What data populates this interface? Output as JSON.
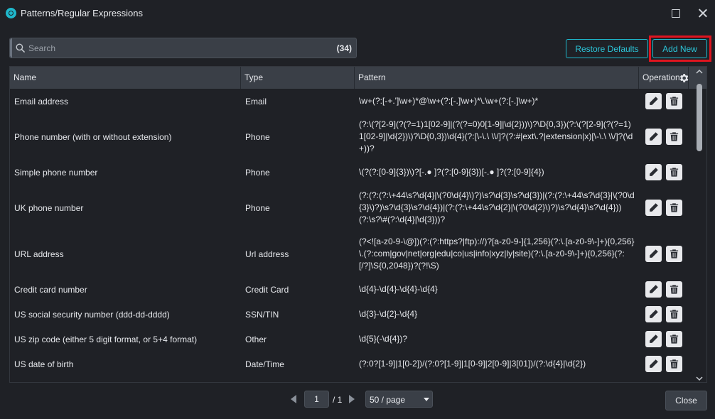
{
  "window": {
    "title": "Patterns/Regular Expressions",
    "icons": {
      "app": "app-logo-icon",
      "maximize": "maximize-icon",
      "close": "close-icon"
    }
  },
  "search": {
    "placeholder": "Search",
    "value": "",
    "count": "(34)"
  },
  "toolbar": {
    "restore_label": "Restore Defaults",
    "add_new_label": "Add New",
    "highlight_color": "#e0141f",
    "accent_color": "#1fb8cc"
  },
  "table": {
    "headers": {
      "name": "Name",
      "type": "Type",
      "pattern": "Pattern",
      "operation": "Operation"
    },
    "rows": [
      {
        "name": "Email address",
        "type": "Email",
        "pattern": "\\w+(?:[-+.']\\w+)*@\\w+(?:[-.]\\w+)*\\.\\w+(?:[-.]\\w+)*"
      },
      {
        "name": "Phone number (with or without extension)",
        "type": "Phone",
        "pattern": "(?:\\(?[2-9](?(?=1)1[02-9]|(?(?=0)0[1-9]|\\d{2}))\\)?\\D{0,3})(?:\\(?[2-9](?(?=1)1[02-9]|\\d{2})\\)?\\D{0,3})\\d{4}(?:[\\-\\.\\ \\\\/]?(?:#|ext\\.?|extension|x)[\\-\\.\\ \\\\/]?(\\d+))?"
      },
      {
        "name": "Simple phone number",
        "type": "Phone",
        "pattern": "\\(?(?:[0-9]{3})\\)?[-.● ]?(?:[0-9]{3})[-.● ]?(?:[0-9]{4})"
      },
      {
        "name": "UK phone number",
        "type": "Phone",
        "pattern": "(?:(?:(?:\\+44\\s?\\d{4}|\\(?0\\d{4}\\)?)\\s?\\d{3}\\s?\\d{3})|(?:(?:\\+44\\s?\\d{3}|\\(?0\\d{3}\\)?)\\s?\\d{3}\\s?\\d{4})|(?:(?:\\+44\\s?\\d{2}|\\(?0\\d{2}\\)?)\\s?\\d{4}\\s?\\d{4}))(?:\\s?\\#(?:\\d{4}|\\d{3}))?"
      },
      {
        "name": "URL address",
        "type": "Url address",
        "pattern": "(?<![a-z0-9-\\@])(?:(?:https?|ftp)://)?[a-z0-9-]{1,256}(?:\\.[a-z0-9\\-]+){0,256}\\.(?:com|gov|net|org|edu|co|us|info|xyz|ly|site)(?:\\.[a-z0-9\\-]+){0,256}(?:[/?]\\S{0,2048})?(?!\\S)"
      },
      {
        "name": "Credit card number",
        "type": "Credit Card",
        "pattern": "\\d{4}-\\d{4}-\\d{4}-\\d{4}"
      },
      {
        "name": "US social security number (ddd-dd-dddd)",
        "type": "SSN/TIN",
        "pattern": "\\d{3}-\\d{2}-\\d{4}"
      },
      {
        "name": "US zip code (either 5 digit format, or 5+4 format)",
        "type": "Other",
        "pattern": "\\d{5}(-\\d{4})?"
      },
      {
        "name": "US date of birth",
        "type": "Date/Time",
        "pattern": "(?:0?[1-9]|1[0-2])/(?:0?[1-9]|1[0-9]|2[0-9]|3[01])/(?:\\d{4}|\\d{2})"
      }
    ],
    "row_icons": {
      "edit": "pencil-icon",
      "delete": "trash-icon"
    },
    "settings_icon": "gear-icon"
  },
  "pagination": {
    "current_page": "1",
    "total": "/ 1",
    "page_size": "50 / page"
  },
  "footer": {
    "close_label": "Close"
  }
}
